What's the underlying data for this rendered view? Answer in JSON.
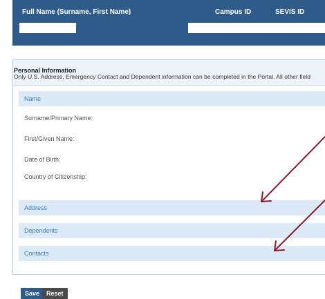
{
  "header": {
    "full_name_label": "Full Name (Surname, First Name)",
    "campus_id_label": "Campus ID",
    "sevis_id_label": "SEVIS ID",
    "full_name_value": "",
    "campus_id_value": ""
  },
  "personal_info": {
    "title": "Personal Information",
    "subtitle": "Only U.S. Address, Emergency Contact and Dependent information can be completed in the Portal. All other field"
  },
  "sections": {
    "name": "Name",
    "address": "Address",
    "dependents": "Dependents",
    "contacts": "Contacts"
  },
  "fields": {
    "surname": "Surname/Primary Name:",
    "first_name": "First/Given Name:",
    "dob": "Date of Birth:",
    "country": "Country of Citizenship:"
  },
  "buttons": {
    "save": "Save",
    "reset": "Reset"
  },
  "colors": {
    "header_bg": "#2f5b8a",
    "section_bg": "#dce9f6",
    "section_text": "#3a7cb8",
    "arrow": "#8b1a2b"
  }
}
